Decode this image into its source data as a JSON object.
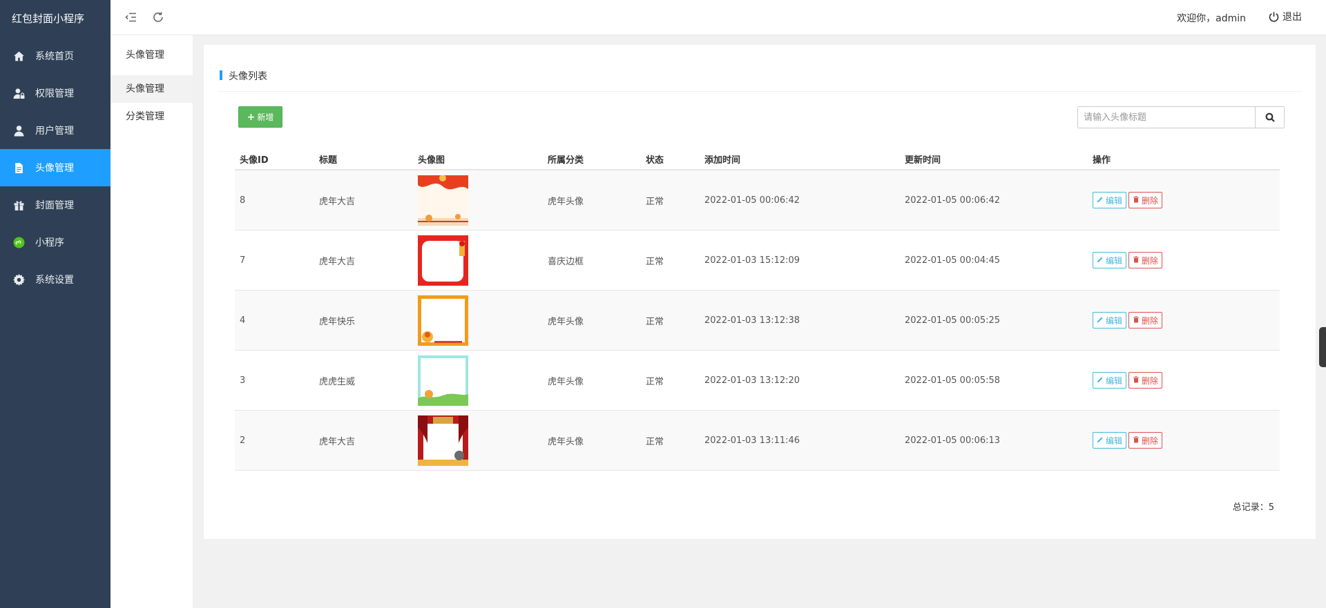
{
  "app": {
    "title": "红包封面小程序"
  },
  "sidebar": {
    "items": [
      {
        "label": "系统首页",
        "icon": "home-icon"
      },
      {
        "label": "权限管理",
        "icon": "user-lock-icon"
      },
      {
        "label": "用户管理",
        "icon": "user-icon"
      },
      {
        "label": "头像管理",
        "icon": "file-icon",
        "active": true
      },
      {
        "label": "封面管理",
        "icon": "gift-icon"
      },
      {
        "label": "小程序",
        "icon": "mini-program-icon"
      },
      {
        "label": "系统设置",
        "icon": "gear-icon"
      }
    ]
  },
  "header": {
    "welcome": "欢迎你，admin",
    "logout_label": "退出"
  },
  "submenu": {
    "title": "头像管理",
    "items": [
      {
        "label": "头像管理",
        "active": true
      },
      {
        "label": "分类管理"
      }
    ]
  },
  "main": {
    "card_title": "头像列表",
    "add_label": "新增",
    "search_placeholder": "请输入头像标题",
    "columns": [
      "头像ID",
      "标题",
      "头像图",
      "所属分类",
      "状态",
      "添加时间",
      "更新时间",
      "操作"
    ],
    "edit_label": "编辑",
    "delete_label": "删除",
    "rows": [
      {
        "id": "8",
        "title": "虎年大吉",
        "category": "虎年头像",
        "status": "正常",
        "added": "2022-01-05 00:06:42",
        "updated": "2022-01-05 00:06:42",
        "thumb": "thumb-red-festive"
      },
      {
        "id": "7",
        "title": "虎年大吉",
        "category": "喜庆边框",
        "status": "正常",
        "added": "2022-01-03 15:12:09",
        "updated": "2022-01-05 00:04:45",
        "thumb": "thumb-red-frame"
      },
      {
        "id": "4",
        "title": "虎年快乐",
        "category": "虎年头像",
        "status": "正常",
        "added": "2022-01-03 13:12:38",
        "updated": "2022-01-05 00:05:25",
        "thumb": "thumb-orange-frame"
      },
      {
        "id": "3",
        "title": "虎虎生威",
        "category": "虎年头像",
        "status": "正常",
        "added": "2022-01-03 13:12:20",
        "updated": "2022-01-05 00:05:58",
        "thumb": "thumb-cyan-frame"
      },
      {
        "id": "2",
        "title": "虎年大吉",
        "category": "虎年头像",
        "status": "正常",
        "added": "2022-01-03 13:11:46",
        "updated": "2022-01-05 00:06:13",
        "thumb": "thumb-stage-frame"
      }
    ],
    "total_label": "总记录：5"
  },
  "colors": {
    "sidebar_bg": "#2f4056",
    "accent": "#1e9fff",
    "add_green": "#5cb85c",
    "edit_blue": "#46b8da",
    "delete_red": "#d9534f"
  }
}
